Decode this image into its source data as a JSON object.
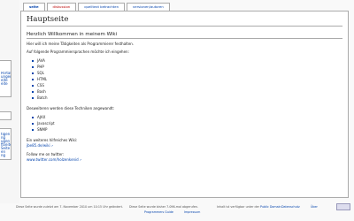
{
  "tabs": [
    {
      "label": "seite",
      "active": true
    },
    {
      "label": "diskussion",
      "missing": true
    },
    {
      "label": "quelltext betrachten"
    },
    {
      "label": "versionen/autoren"
    }
  ],
  "sidebar": {
    "links_top": [
      "Portal",
      "ungen",
      "eite",
      "eite"
    ],
    "links_mid": [
      "tigen",
      "ng",
      "ugen",
      "ftseite"
    ],
    "links_low": [
      "Seite",
      "en",
      "ng"
    ]
  },
  "page": {
    "title": "Hauptseite",
    "subtitle": "Herzlich Willkommen in meinem Wiki",
    "intro": "Hier will ich meine Tätigkeiten als Programmierer festhalten.",
    "languages_intro": "Auf folgende Programmiersprachen möchte ich eingehen:",
    "languages": [
      "JAVA",
      "PHP",
      "SQL",
      "HTML",
      "CSS",
      "Bash",
      "Batch"
    ],
    "techniques_intro": "Desweiteren werden diese Techniken angewandt:",
    "techniques": [
      "AJAX",
      "Javascript",
      "SNMP"
    ],
    "other_wiki_label": "Ein weiteres hilfreiches Wiki:",
    "other_wiki_link": "jbe85.de/wiki",
    "twitter_label": "Follow me on twitter:",
    "twitter_link": "www.twitter.com/holzenkenid"
  },
  "footer": {
    "line1a": "Diese Seite wurde zuletzt am 7. November 2010 um 10:15 Uhr geändert.",
    "line1b": "Diese Seite wurde bisher 7.096-mal abgerufen.",
    "line1c": "Inhalt ist verfügbar unter der",
    "public_domain": "Public Domain",
    "privacy": "Datenschutz",
    "about": "Über",
    "programmers_guide": "Programmers Guide",
    "impressum": "Impressum"
  }
}
